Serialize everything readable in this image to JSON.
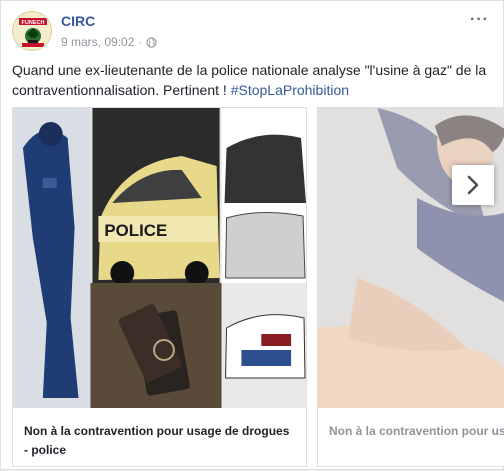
{
  "post": {
    "author": "CIRC",
    "timestamp": "9 mars, 09:02",
    "separator": "·",
    "more_label": "···",
    "text_before": "Quand une ex-lieutenante de la police nationale analyse \"l'usine à gaz\" de la contraventionnalisation. Pertinent ! ",
    "hashtag": "#StopLaProhibition"
  },
  "avatar": {
    "logo_text": "FUNECH",
    "icon": "circ-logo"
  },
  "icons": {
    "privacy": "globe-icon",
    "next": "chevron-right-icon",
    "more": "more-options-icon"
  },
  "carousel": {
    "cards": [
      {
        "caption": "Non à la contravention pour usage de drogues - police"
      },
      {
        "caption": "Non à la contravention pour usage de drogues - police"
      }
    ]
  },
  "colors": {
    "link": "#365899",
    "meta": "#90949c",
    "text": "#1d2129",
    "border": "#dddfe2"
  }
}
